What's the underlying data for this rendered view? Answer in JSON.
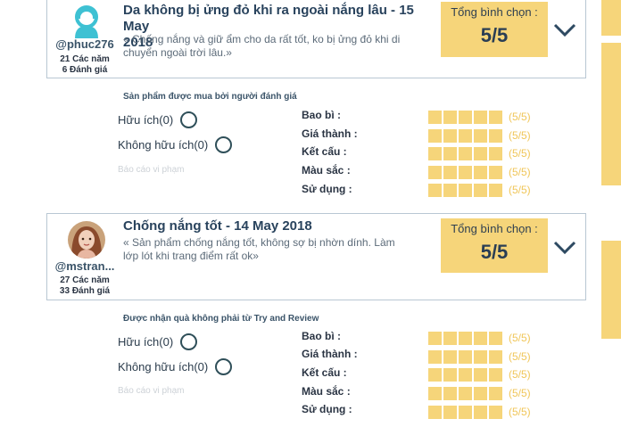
{
  "reviews": [
    {
      "username": "@phuc276",
      "years": "21 Các năm",
      "ratings_count": "6 Đánh giá",
      "avatar": "user-silhouette-avatar",
      "title_line1": "Da không bị ửng đỏ khi ra ngoài nắng lâu - 15 May",
      "title_line2": "2018",
      "comment_line1": "« Chống nắng và giữ ẩm cho da rất tốt, ko bị ửng đỏ khi di",
      "comment_line2": "chuyển ngoài trời lâu.»",
      "score_label": "Tổng bình chọn :",
      "score": "5/5",
      "verified": "Sản phẩm được mua bởi người đánh giá",
      "helpful": "Hữu ích(0)",
      "not_helpful": "Không hữu ích(0)",
      "report": "Báo cáo vi phạm",
      "criteria": [
        {
          "label": "Bao bì :",
          "score": "(5/5)",
          "value": 5
        },
        {
          "label": "Giá thành :",
          "score": "(5/5)",
          "value": 5
        },
        {
          "label": "Kết cấu :",
          "score": "(5/5)",
          "value": 5
        },
        {
          "label": "Màu sắc :",
          "score": "(5/5)",
          "value": 5
        },
        {
          "label": "Sử dụng :",
          "score": "(5/5)",
          "value": 5
        }
      ]
    },
    {
      "username": "@mstran...",
      "years": "27 Các năm",
      "ratings_count": "33 Đánh giá",
      "avatar": "user-photo-avatar",
      "title_line1": "Chống nắng tốt - 14 May 2018",
      "comment_line1": "« Sản phẩm chống nắng tốt, không sợ bị nhờn dính. Làm",
      "comment_line2": "lớp lót khi trang điểm rất ok»",
      "score_label": "Tổng bình chọn :",
      "score": "5/5",
      "verified": "Được nhận quà không phải từ Try and Review",
      "helpful": "Hữu ích(0)",
      "not_helpful": "Không hữu ích(0)",
      "report": "Báo cáo vi phạm",
      "criteria": [
        {
          "label": "Bao bì :",
          "score": "(5/5)",
          "value": 5
        },
        {
          "label": "Giá thành :",
          "score": "(5/5)",
          "value": 5
        },
        {
          "label": "Kết cấu :",
          "score": "(5/5)",
          "value": 5
        },
        {
          "label": "Màu sắc :",
          "score": "(5/5)",
          "value": 5
        },
        {
          "label": "Sử dụng :",
          "score": "(5/5)",
          "value": 5
        }
      ]
    }
  ],
  "colors": {
    "accent": "#f6d57a",
    "text": "#2a3f55",
    "score_text": "#f0c659",
    "border": "#b9c7d3"
  }
}
